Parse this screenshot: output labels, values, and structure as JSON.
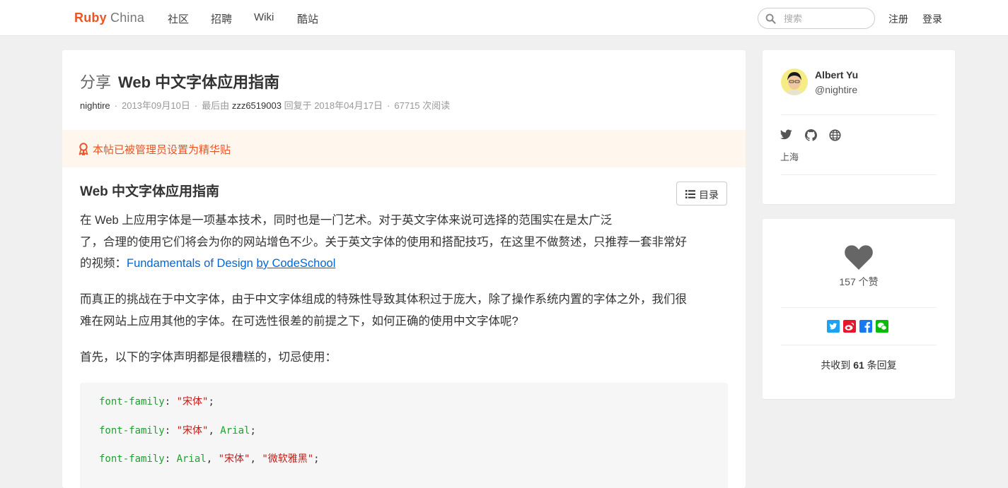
{
  "navbar": {
    "brand_part1": "Ruby",
    "brand_part2": "China",
    "items": [
      "社区",
      "招聘",
      "Wiki",
      "酷站"
    ],
    "search_placeholder": "搜索",
    "signup": "注册",
    "login": "登录"
  },
  "topic": {
    "node": "分享",
    "title": "Web 中文字体应用指南",
    "author": "nightire",
    "created_at": "2013年09月10日",
    "last_reply_prefix": "最后由",
    "last_reply_user": "zzz6519003",
    "last_reply_suffix": "回复于",
    "last_reply_at": "2018年04月17日",
    "hits": "67715 次阅读",
    "excellent_notice": "本帖已被管理员设置为精华贴",
    "toc_label": "目录",
    "heading": "Web 中文字体应用指南",
    "para1_line1": "在 Web 上应用字体是一项基本技术，同时也是一门艺术。对于英文字体来说可选择的范围实在是太广泛",
    "para1_line2": "了，合理的使用它们将会为你的网站增色不少。关于英文字体的使用和搭配技巧，在这里不做赘述，只推荐一套非常好",
    "para1_line3_prefix": "的视频：",
    "link1": "Fundamentals of Design",
    "link2": "by CodeSchool",
    "para2_line1": "而真正的挑战在于中文字体，由于中文字体组成的特殊性导致其体积过于庞大，除了操作系统内置的字体之外，我们很",
    "para2_line2": "难在网站上应用其他的字体。在可选性很差的前提之下，如何正确的使用中文字体呢?",
    "para3": "首先，以下的字体声明都是很糟糕的，切忌使用：",
    "code": {
      "prop": "font-family",
      "s_song": "\"宋体\"",
      "arial": "Arial",
      "s_yahei": "\"微软雅黑\""
    }
  },
  "sidebar": {
    "user_name": "Albert Yu",
    "user_login": "@nightire",
    "location": "上海",
    "likes": "157 个赞",
    "replies_prefix": "共收到",
    "replies_count": "61",
    "replies_suffix": "条回复"
  },
  "colors": {
    "brand": "#eb5424",
    "link": "#0366d6",
    "excellent_bg": "#fff6ee",
    "code_keyword": "#1fa032",
    "code_string": "#c41a16"
  }
}
